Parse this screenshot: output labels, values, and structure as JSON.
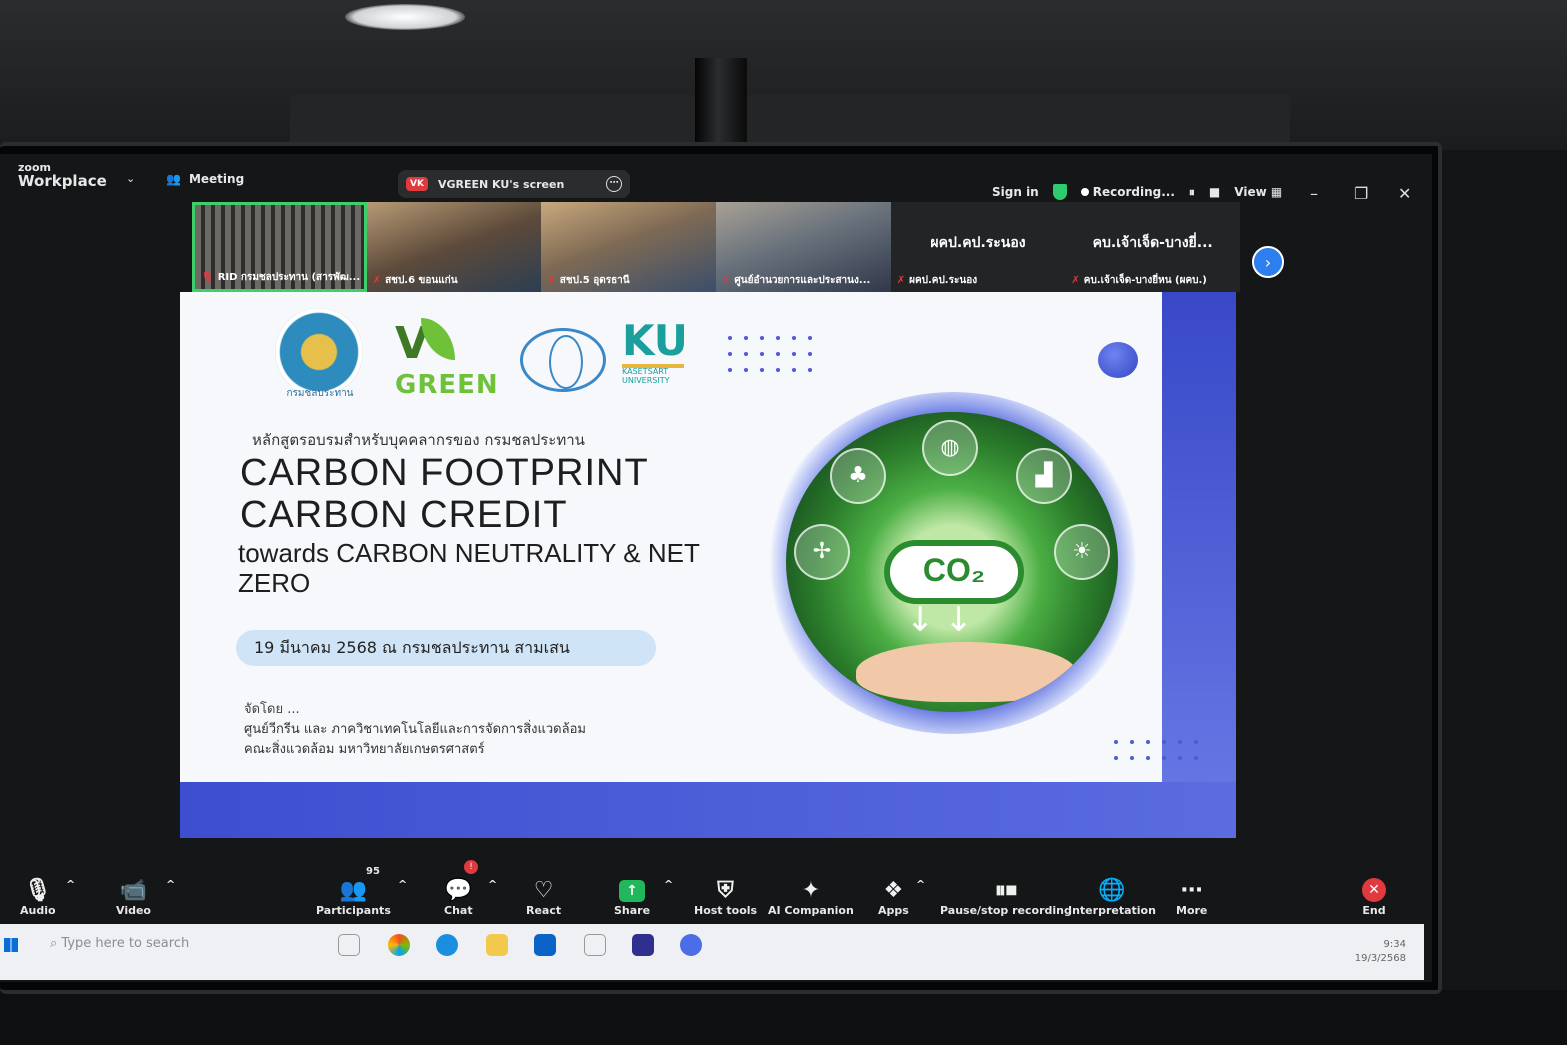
{
  "app": {
    "brand_small": "zoom",
    "brand_big": "Workplace",
    "meeting_label": "Meeting",
    "share_badge": "VK",
    "share_title": "VGREEN KU's screen",
    "sign_in": "Sign in",
    "recording_label": "Recording...",
    "view_label": "View"
  },
  "participants": [
    {
      "label": "RID กรมชลประทาน (สารพัฒ..."
    },
    {
      "label": "สชป.6 ขอนแก่น"
    },
    {
      "label": "สชป.5 อุดรธานี"
    },
    {
      "label": "ศูนย์อำนวยการและประสานง..."
    },
    {
      "name": "ผคป.คป.ระนอง",
      "label": "ผคป.คป.ระนอง"
    },
    {
      "name": "คบ.เจ้าเจ็ด-บางยี่...",
      "label": "คบ.เจ้าเจ็ด-บางยี่หน (ผคบ.)"
    }
  ],
  "slide": {
    "seal_caption": "กรมชลประทาน",
    "vgreen_v": "V",
    "vgreen_word": "GREEN",
    "ku_letters": "KU",
    "ku_sub_1": "KASETSART",
    "ku_sub_2": "UNIVERSITY",
    "course": "หลักสูตรอบรมสำหรับบุคคลากรของ กรมชลประทาน",
    "title_1": "CARBON FOOTPRINT",
    "title_2": "CARBON CREDIT",
    "title_3": "towards CARBON NEUTRALITY & NET ZERO",
    "date": "19 มีนาคม 2568 ณ กรมชลประทาน สามเสน",
    "org_label": "จัดโดย ...",
    "org_line_1": "ศูนย์วีกรีน และ ภาควิชาเทคโนโลยีและการจัดการสิ่งแวดล้อม",
    "org_line_2": "คณะสิ่งแวดล้อม มหาวิทยาลัยเกษตรศาสตร์",
    "co2": "CO₂"
  },
  "toolbar": {
    "audio": "Audio",
    "video": "Video",
    "participants": "Participants",
    "participants_count": "95",
    "chat": "Chat",
    "react": "React",
    "share": "Share",
    "host_tools": "Host tools",
    "ai_companion": "AI Companion",
    "apps": "Apps",
    "pause_recording": "Pause/stop recording",
    "interpretation": "Interpretation",
    "more": "More",
    "end": "End"
  },
  "taskbar": {
    "search_placeholder": "Type here to search",
    "time": "9:34",
    "date": "19/3/2568"
  },
  "colors": {
    "zoom_green": "#20b85a",
    "end_red": "#e0393e",
    "slide_blue": "#4a5bd6",
    "active_speaker": "#3ccf6a"
  }
}
